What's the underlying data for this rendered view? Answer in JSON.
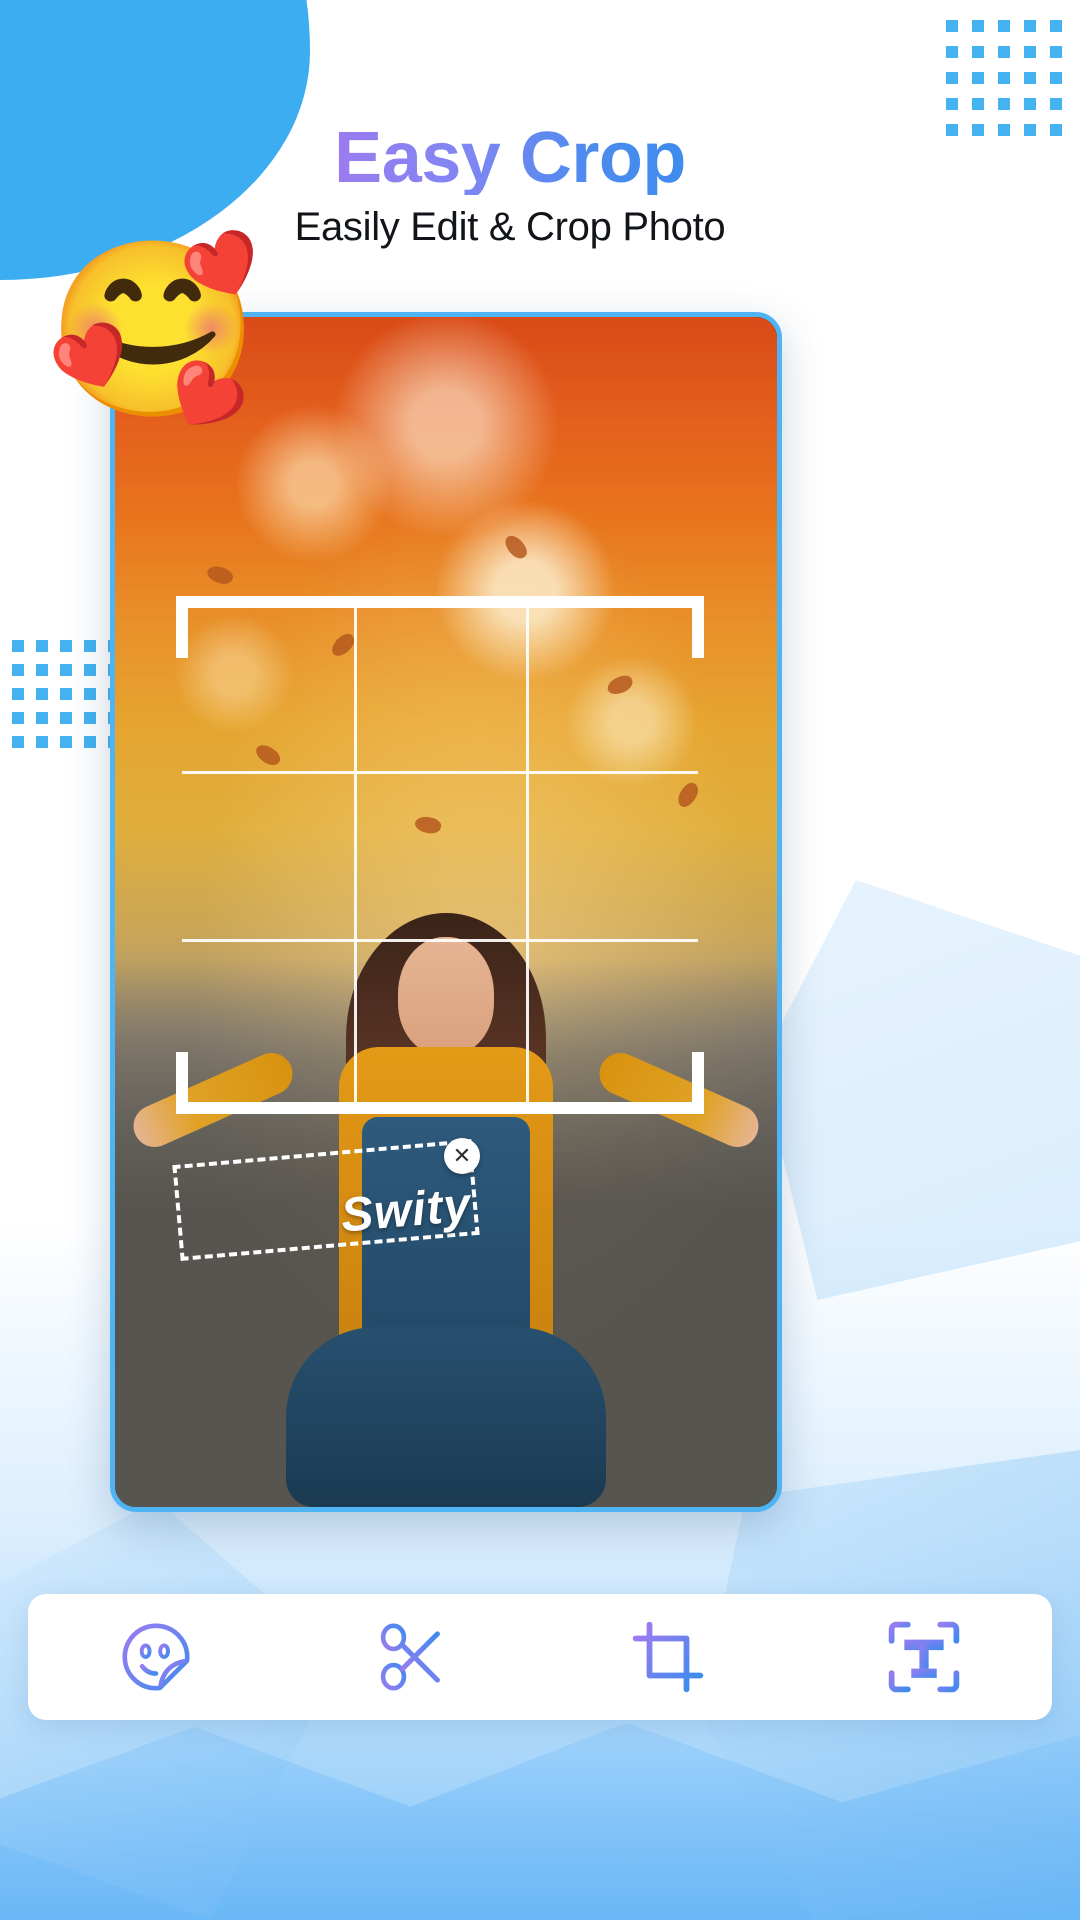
{
  "header": {
    "title": "Easy Crop",
    "subtitle": "Easily Edit & Crop Photo"
  },
  "decor": {
    "hero_emoji": "🥰",
    "emoji_name": "smiling-face-with-hearts",
    "blob_color": "#3BADF0",
    "dot_color": "#45B2F2",
    "title_gradient_start": "#9B7BF0",
    "title_gradient_end": "#4D8BEE",
    "phone_border_color": "#4FB4F4"
  },
  "editor": {
    "sticker_text": "Swity",
    "close_label": "✕",
    "crop_grid_rows": 3,
    "crop_grid_cols": 3
  },
  "toolbar": {
    "items": [
      {
        "id": "sticker",
        "label": "Sticker",
        "icon": "sticker-smiley-icon"
      },
      {
        "id": "cut",
        "label": "Cut",
        "icon": "scissors-icon"
      },
      {
        "id": "crop",
        "label": "Crop",
        "icon": "crop-icon"
      },
      {
        "id": "text",
        "label": "Text",
        "icon": "text-tool-icon"
      }
    ]
  }
}
